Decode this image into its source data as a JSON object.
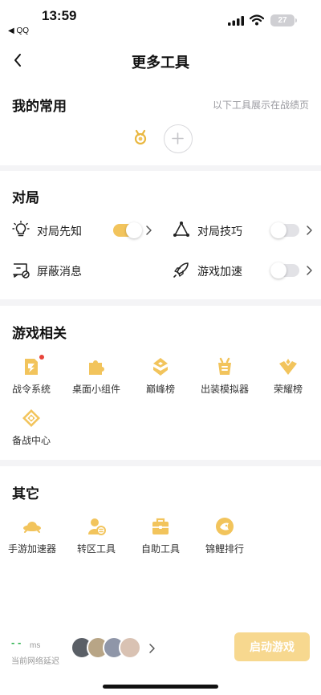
{
  "status_bar": {
    "time": "13:59",
    "back_app": "◀ QQ",
    "battery": "27"
  },
  "nav": {
    "title": "更多工具"
  },
  "favorites": {
    "title": "我的常用",
    "hint": "以下工具展示在战绩页"
  },
  "match": {
    "title": "对局",
    "rows": [
      {
        "label": "对局先知",
        "state": "on"
      },
      {
        "label": "对局技巧",
        "state": "off"
      },
      {
        "label": "屏蔽消息"
      },
      {
        "label": "游戏加速",
        "state": "off"
      }
    ]
  },
  "game_related": {
    "title": "游戏相关",
    "items": [
      {
        "label": "战令系统"
      },
      {
        "label": "桌面小组件"
      },
      {
        "label": "巅峰榜"
      },
      {
        "label": "出装模拟器"
      },
      {
        "label": "荣耀榜"
      },
      {
        "label": "备战中心"
      }
    ]
  },
  "other": {
    "title": "其它",
    "items": [
      {
        "label": "手游加速器"
      },
      {
        "label": "转区工具"
      },
      {
        "label": "自助工具"
      },
      {
        "label": "锦鲤排行"
      }
    ]
  },
  "bottom": {
    "latency_value": "- -",
    "latency_unit": "ms",
    "latency_label": "当前网络延迟",
    "start_label": "启动游戏"
  },
  "colors": {
    "accent": "#f2c45c",
    "accent_light": "#f7d88f",
    "latency_green": "#2bb24c",
    "red_dot": "#e8443a"
  }
}
